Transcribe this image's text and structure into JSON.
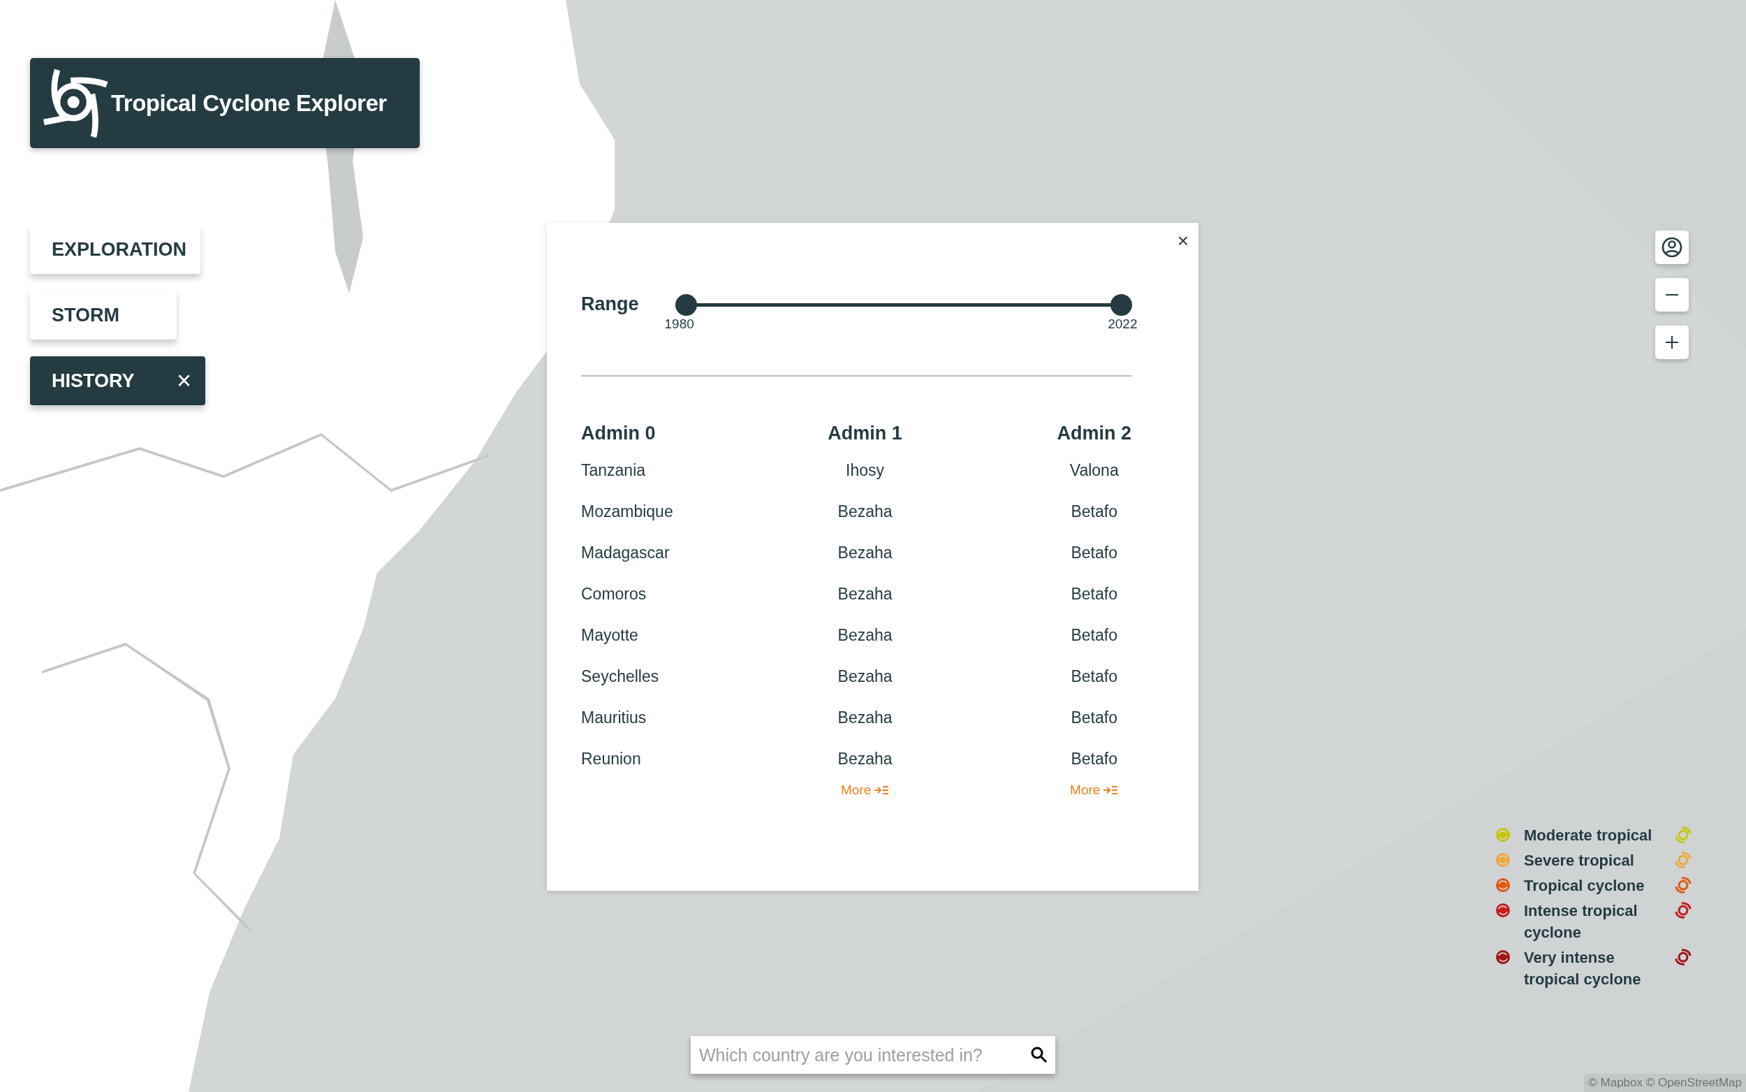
{
  "header": {
    "title": "Tropical Cyclone Explorer"
  },
  "nav": [
    {
      "label": "EXPLORATION",
      "selected": false
    },
    {
      "label": "STORM",
      "selected": false
    },
    {
      "label": "HISTORY",
      "selected": true,
      "close": "×"
    }
  ],
  "panel": {
    "close": "×",
    "range": {
      "label": "Range",
      "thumbs": [
        {
          "level": 0,
          "reading": "1980"
        },
        {
          "level": 1,
          "reading": "2022"
        }
      ]
    },
    "columns": [
      {
        "title": "Admin 0",
        "cells": [
          "Tanzania",
          "Mozambique",
          "Madagascar",
          "Comoros",
          "Mayotte",
          "Seychelles",
          "Mauritius",
          "Reunion"
        ]
      },
      {
        "title": "Admin 1",
        "cells": [
          "Ihosy",
          "Bezaha",
          "Bezaha",
          "Bezaha",
          "Bezaha",
          "Bezaha",
          "Bezaha",
          "Bezaha"
        ],
        "more": "More"
      },
      {
        "title": "Admin 2",
        "cells": [
          "Valona",
          "Betafo",
          "Betafo",
          "Betafo",
          "Betafo",
          "Betafo",
          "Betafo",
          "Betafo"
        ],
        "more": "More"
      }
    ]
  },
  "map_controls": [
    {
      "kind": "account"
    },
    {
      "kind": "zoom_out"
    },
    {
      "kind": "zoom_in"
    }
  ],
  "legend": [
    {
      "label": "Moderate tropical",
      "color": "#c5c60a"
    },
    {
      "label": "Severe tropical",
      "color": "#f0a83a"
    },
    {
      "label": "Tropical cyclone",
      "color": "#e05a10"
    },
    {
      "label": "Intense tropical cyclone",
      "color": "#c71c1c"
    },
    {
      "label": "Very intense tropical cyclone",
      "color": "#a01515"
    }
  ],
  "search": {
    "placeholder": "Which country are you interested in?"
  },
  "attribution": "© Mapbox © OpenStreetMap"
}
